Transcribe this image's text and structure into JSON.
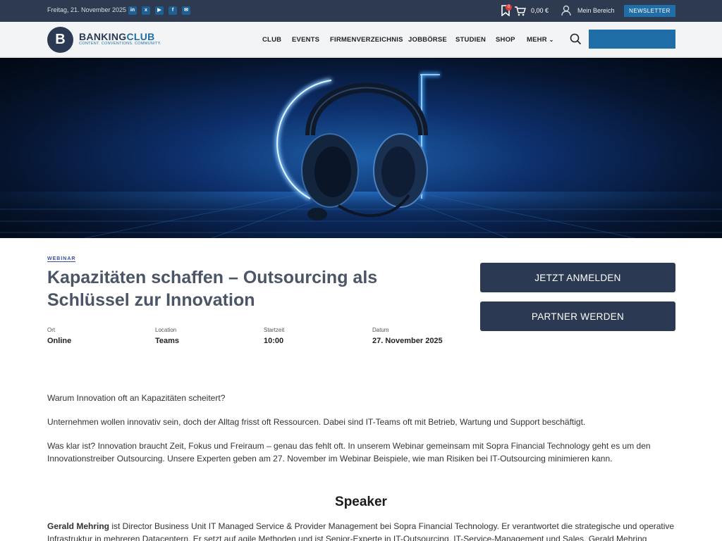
{
  "topbar": {
    "date": "Freitag, 21. November 2025",
    "social_icons": [
      "linkedin-icon",
      "xing-icon",
      "youtube-icon",
      "facebook-icon",
      "mail-icon"
    ],
    "bookmark_count": "0",
    "cart_total": "0,00 €",
    "account_label": "Mein Bereich",
    "newsletter_label": "NEWSLETTER"
  },
  "brand": {
    "logo_letter": "B",
    "name_part1": "BANKING",
    "name_part2": "CLUB",
    "tagline": "CONTENT. CONVENTIONS. COMMUNITY."
  },
  "nav": {
    "items": [
      "CLUB",
      "EVENTS",
      "FIRMENVERZEICHNIS",
      "JOBBÖRSE",
      "STUDIEN",
      "SHOP",
      "MEHR"
    ]
  },
  "event": {
    "tag": "WEBINAR",
    "title": "Kapazitäten schaffen – Outsourcing als Schlüssel zur Innovation",
    "meta": [
      {
        "label": "Ort",
        "value": "Online"
      },
      {
        "label": "Location",
        "value": "Teams"
      },
      {
        "label": "Startzeit",
        "value": "10:00"
      },
      {
        "label": "Datum",
        "value": "27. November 2025"
      }
    ],
    "register_label": "JETZT ANMELDEN",
    "partner_label": "PARTNER WERDEN"
  },
  "body": {
    "p1": "Warum Innovation oft an Kapazitäten scheitert?",
    "p2": "Unternehmen wollen innovativ sein, doch der Alltag frisst oft Ressourcen. Dabei sind IT-Teams oft mit Betrieb, Wartung und Support beschäftigt.",
    "p3": "Was klar ist? Innovation braucht Zeit, Fokus und Freiraum – genau das fehlt oft. In unserem Webinar gemeinsam mit Sopra Financial Technology geht es um den Innovationstreiber Outsourcing. Unsere Experten geben am 27. November im Webinar Beispiele, wie man Risiken bei IT-Outsourcing minimieren kann.",
    "speaker_heading": "Speaker",
    "speaker_name": "Gerald Mehring",
    "speaker_bio": " ist Director Business Unit IT Managed Service & Provider Management bei Sopra Financial Technology. Er verantwortet die strategische und operative Infrastruktur in mehreren Datacentern. Er setzt auf agile Methoden und ist Senior-Experte in IT-Outsourcing, IT-Service-Management und Sales. Gerald Mehring"
  },
  "colors": {
    "topbar_bg": "#2d3a4f",
    "brand_blue": "#1f6ea8",
    "button_dark": "#2b3a52"
  }
}
